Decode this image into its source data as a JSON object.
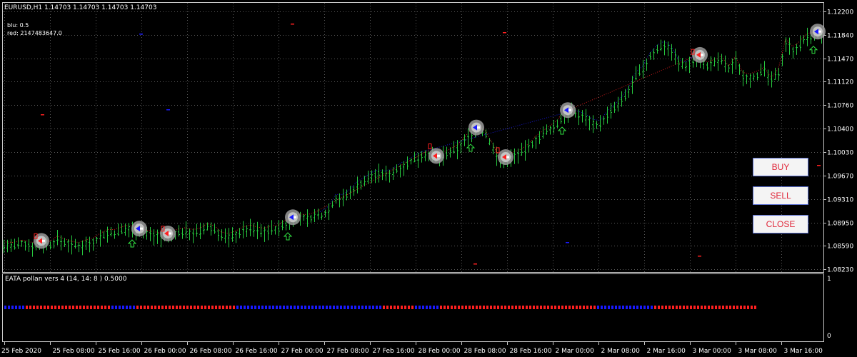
{
  "window": {
    "symbol_line": "EURUSD,H1  1.14703 1.14703 1.14703 1.14703",
    "indicator_lines": [
      "blu: 0.5",
      "red: 2147483647.0"
    ]
  },
  "buttons": {
    "buy": "BUY",
    "sell": "SELL",
    "close": "CLOSE"
  },
  "colors": {
    "background": "#000000",
    "grid": "#5a5a5a",
    "bars": "#27c93f",
    "blue": "#1a1aff",
    "red": "#ff2020",
    "button_text": "#e0283a"
  },
  "icons": {
    "buy_signal": "blue-arrow-on-gray-disc-icon",
    "sell_signal": "red-arrow-on-gray-disc-icon",
    "up_arrow": "green-up-arrow-icon",
    "fractal_up": "red-fractal-marker-icon"
  },
  "indicator": {
    "title": "EATA pollan vers 4 (14, 14: 8 ) 0.5000",
    "scale": [
      "1",
      "0"
    ],
    "segments": [
      {
        "color": "blue",
        "count": 6
      },
      {
        "color": "red",
        "count": 24
      },
      {
        "color": "blue",
        "count": 7
      },
      {
        "color": "red",
        "count": 28
      },
      {
        "color": "blue",
        "count": 41
      },
      {
        "color": "red",
        "count": 9
      },
      {
        "color": "blue",
        "count": 7
      },
      {
        "color": "red",
        "count": 44
      },
      {
        "color": "blue",
        "count": 16
      },
      {
        "color": "red",
        "count": 29
      }
    ]
  },
  "chart_data": {
    "type": "candlestick-bars",
    "title": "EURUSD,H1",
    "y_ticks": [
      "1.12200",
      "1.11840",
      "1.11470",
      "1.11120",
      "1.10760",
      "1.10400",
      "1.10030",
      "1.09670",
      "1.09310",
      "1.08950",
      "1.08590",
      "1.08230"
    ],
    "ylim": [
      1.0823,
      1.122
    ],
    "x_ticks": [
      "25 Feb 2020",
      "25 Feb 08:00",
      "25 Feb 16:00",
      "26 Feb 00:00",
      "26 Feb 08:00",
      "26 Feb 16:00",
      "27 Feb 00:00",
      "27 Feb 08:00",
      "27 Feb 16:00",
      "28 Feb 00:00",
      "28 Feb 08:00",
      "28 Feb 16:00",
      "2 Mar 00:00",
      "2 Mar 08:00",
      "2 Mar 16:00",
      "3 Mar 00:00",
      "3 Mar 08:00",
      "3 Mar 16:00"
    ],
    "close_path": [
      [
        0,
        1.0858
      ],
      [
        10,
        1.0859
      ],
      [
        20,
        1.0858
      ],
      [
        30,
        1.0862
      ],
      [
        40,
        1.086
      ],
      [
        45,
        1.0858
      ],
      [
        50,
        1.086
      ],
      [
        60,
        1.0862
      ],
      [
        70,
        1.086
      ],
      [
        80,
        1.0868
      ],
      [
        90,
        1.0864
      ],
      [
        100,
        1.086
      ],
      [
        110,
        1.0858
      ],
      [
        120,
        1.0862
      ],
      [
        130,
        1.0865
      ],
      [
        140,
        1.0872
      ],
      [
        150,
        1.0878
      ],
      [
        160,
        1.0878
      ],
      [
        170,
        1.0882
      ],
      [
        180,
        1.0885
      ],
      [
        190,
        1.0882
      ],
      [
        200,
        1.0879
      ],
      [
        210,
        1.0876
      ],
      [
        220,
        1.0874
      ],
      [
        230,
        1.0871
      ],
      [
        240,
        1.0875
      ],
      [
        250,
        1.0879
      ],
      [
        260,
        1.0881
      ],
      [
        270,
        1.0878
      ],
      [
        280,
        1.088
      ],
      [
        290,
        1.0887
      ],
      [
        300,
        1.0884
      ],
      [
        310,
        1.0874
      ],
      [
        320,
        1.0872
      ],
      [
        330,
        1.0876
      ],
      [
        340,
        1.0882
      ],
      [
        350,
        1.0885
      ],
      [
        360,
        1.0882
      ],
      [
        370,
        1.088
      ],
      [
        380,
        1.0884
      ],
      [
        390,
        1.0885
      ],
      [
        400,
        1.0893
      ],
      [
        410,
        1.0898
      ],
      [
        420,
        1.0902
      ],
      [
        430,
        1.0901
      ],
      [
        440,
        1.0904
      ],
      [
        450,
        1.0906
      ],
      [
        460,
        1.0914
      ],
      [
        470,
        1.0932
      ],
      [
        480,
        1.0932
      ],
      [
        490,
        1.094
      ],
      [
        500,
        1.0952
      ],
      [
        510,
        1.0958
      ],
      [
        520,
        1.0966
      ],
      [
        530,
        1.097
      ],
      [
        540,
        1.0968
      ],
      [
        550,
        1.0972
      ],
      [
        560,
        1.098
      ],
      [
        570,
        1.0985
      ],
      [
        580,
        1.0992
      ],
      [
        590,
        1.0998
      ],
      [
        600,
        1.1
      ],
      [
        610,
        1.0992
      ],
      [
        620,
        1.0997
      ],
      [
        630,
        1.1002
      ],
      [
        640,
        1.1008
      ],
      [
        650,
        1.102
      ],
      [
        660,
        1.1032
      ],
      [
        670,
        1.1038
      ],
      [
        680,
        1.103
      ],
      [
        690,
        1.101
      ],
      [
        700,
        1.0985
      ],
      [
        710,
        1.0992
      ],
      [
        720,
        1.0998
      ],
      [
        730,
        1.1002
      ],
      [
        740,
        1.101
      ],
      [
        750,
        1.1022
      ],
      [
        760,
        1.103
      ],
      [
        770,
        1.1038
      ],
      [
        780,
        1.1046
      ],
      [
        790,
        1.1062
      ],
      [
        800,
        1.1064
      ],
      [
        810,
        1.106
      ],
      [
        820,
        1.1056
      ],
      [
        830,
        1.1048
      ],
      [
        840,
        1.1046
      ],
      [
        850,
        1.106
      ],
      [
        860,
        1.107
      ],
      [
        870,
        1.1082
      ],
      [
        880,
        1.1096
      ],
      [
        890,
        1.112
      ],
      [
        900,
        1.113
      ],
      [
        910,
        1.115
      ],
      [
        920,
        1.1162
      ],
      [
        930,
        1.1168
      ],
      [
        940,
        1.116
      ],
      [
        950,
        1.114
      ],
      [
        960,
        1.1136
      ],
      [
        970,
        1.1144
      ],
      [
        980,
        1.1148
      ],
      [
        990,
        1.1136
      ],
      [
        1000,
        1.114
      ],
      [
        1010,
        1.1145
      ],
      [
        1020,
        1.113
      ],
      [
        1030,
        1.1145
      ],
      [
        1040,
        1.112
      ],
      [
        1050,
        1.1118
      ],
      [
        1060,
        1.1122
      ],
      [
        1070,
        1.1128
      ],
      [
        1080,
        1.1112
      ],
      [
        1090,
        1.1126
      ],
      [
        1100,
        1.1172
      ],
      [
        1110,
        1.116
      ],
      [
        1120,
        1.1168
      ],
      [
        1130,
        1.118
      ],
      [
        1140,
        1.1182
      ],
      [
        1145,
        1.1184
      ]
    ],
    "signals": [
      {
        "bar_x": 58,
        "price": 1.0864,
        "type": "sell"
      },
      {
        "bar_x": 195,
        "price": 1.0884,
        "type": "buy"
      },
      {
        "bar_x": 235,
        "price": 1.0873,
        "type": "sell"
      },
      {
        "bar_x": 410,
        "price": 1.0901,
        "type": "buy"
      },
      {
        "bar_x": 611,
        "price": 0.0,
        "type": "sell"
      },
      {
        "bar_x": 667,
        "price": 0.0,
        "type": "buy"
      },
      {
        "bar_x": 708,
        "price": 0.0,
        "type": "sell"
      },
      {
        "bar_x": 795,
        "price": 0.0,
        "type": "buy"
      },
      {
        "bar_x": 980,
        "price": 0.0,
        "type": "sell"
      },
      {
        "bar_x": 1145,
        "price": 0.0,
        "type": "buy"
      }
    ],
    "up_arrows": [
      185,
      403,
      659,
      787,
      1139
    ],
    "fractals": [
      50,
      228,
      602,
      697,
      970
    ]
  }
}
